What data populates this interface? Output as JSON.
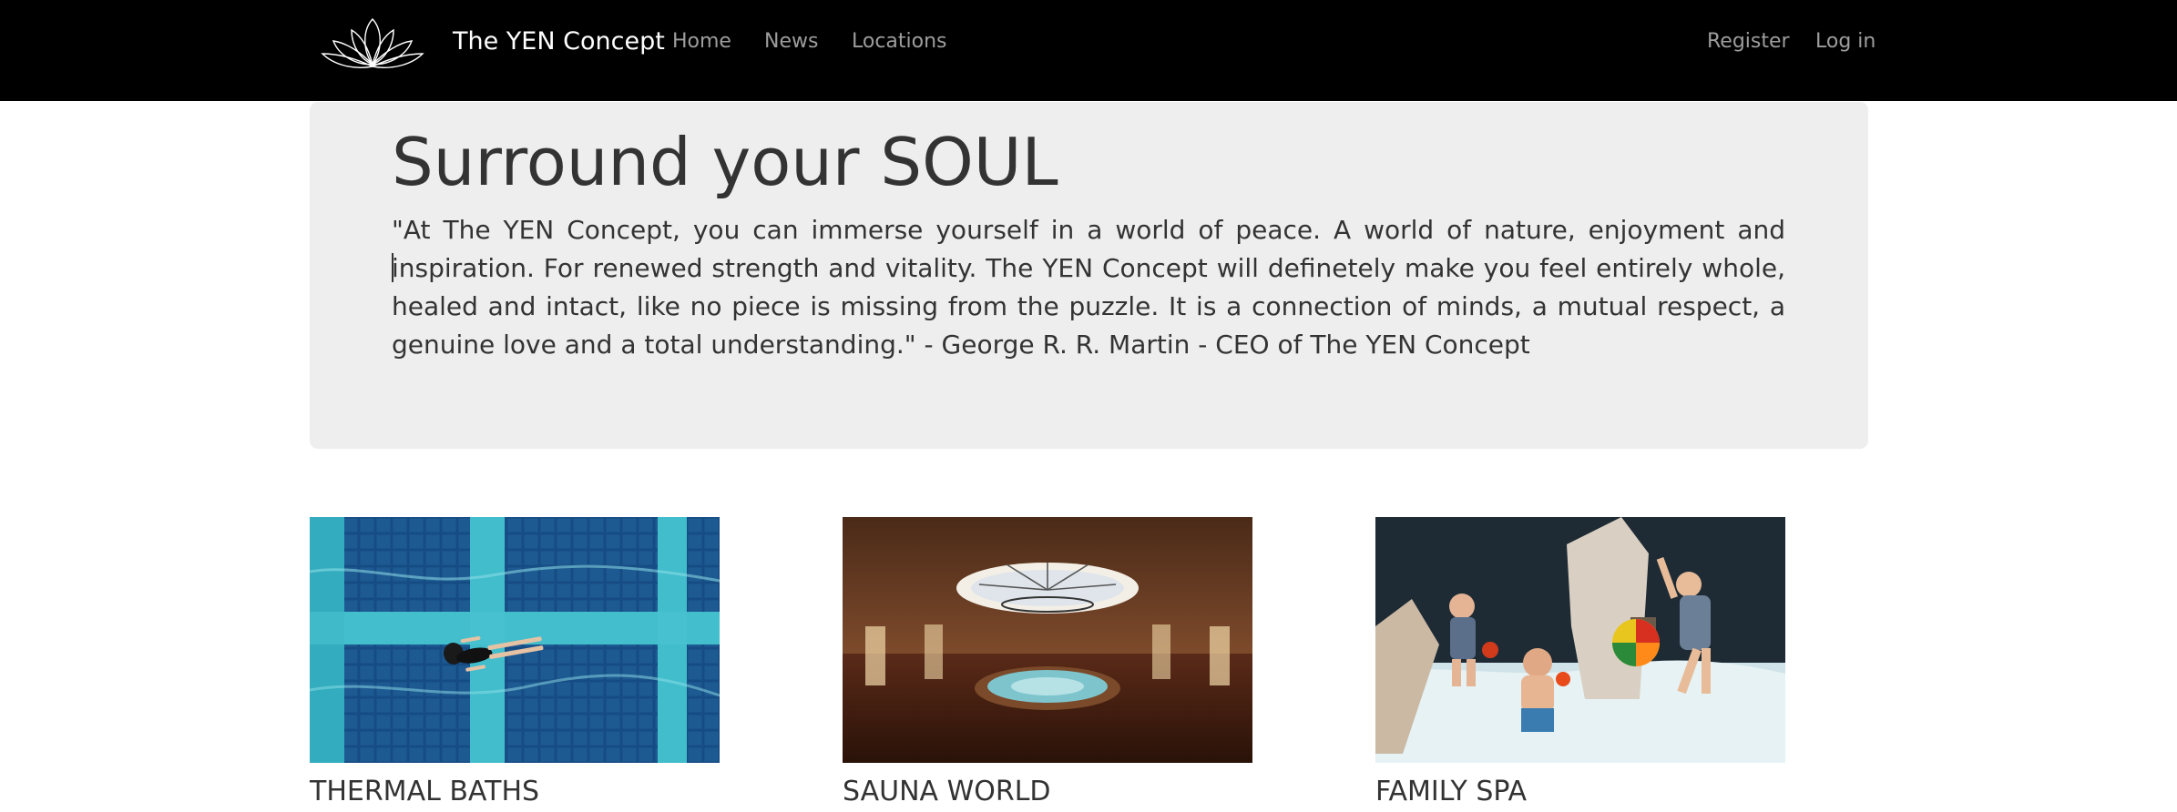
{
  "nav": {
    "brand": "The YEN Concept",
    "links": [
      "Home",
      "News",
      "Locations"
    ],
    "register": "Register",
    "login": "Log in",
    "logo_icon": "lotus-icon"
  },
  "hero": {
    "title": "Surround your SOUL",
    "quote": "\"At The YEN Concept, you can immerse yourself in a world of peace. A world of nature, enjoyment and inspiration. For renewed strength and vitality. The YEN Concept will definetely make you feel entirely whole, healed and intact, like no piece is missing from the puzzle. It is a connection of minds, a mutual respect, a genuine love and a total understanding.\" - George R. R. Martin - CEO of The YEN Concept"
  },
  "cards": [
    {
      "title": "THERMAL BATHS",
      "image": "swimmer-in-pool-photo"
    },
    {
      "title": "SAUNA WORLD",
      "image": "sauna-dome-photo"
    },
    {
      "title": "FAMILY SPA",
      "image": "children-playing-in-water-photo"
    }
  ],
  "colors": {
    "navbar_bg": "#000000",
    "brand_text": "#ffffff",
    "nav_link": "#9d9d9d",
    "jumbotron_bg": "#eeeeee",
    "body_text": "#333333"
  }
}
